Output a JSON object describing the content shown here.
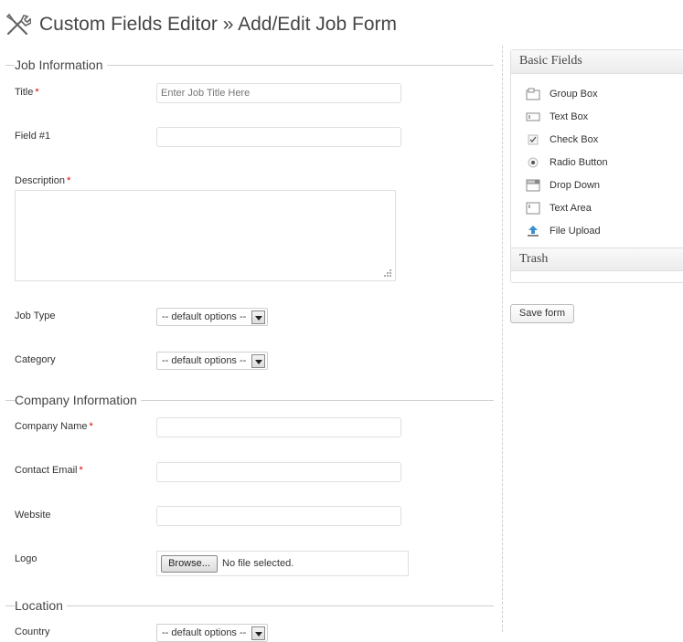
{
  "header": {
    "title": "Custom Fields Editor » Add/Edit Job Form",
    "icon": "tools-icon"
  },
  "sections": {
    "job": {
      "legend": "Job Information",
      "title_label": "Title",
      "title_placeholder": "Enter Job Title Here",
      "field1_label": "Field #1",
      "description_label": "Description",
      "job_type_label": "Job Type",
      "job_type_value": "-- default options --",
      "category_label": "Category",
      "category_value": "-- default options --"
    },
    "company": {
      "legend": "Company Information",
      "company_name_label": "Company Name",
      "contact_email_label": "Contact Email",
      "website_label": "Website",
      "logo_label": "Logo",
      "browse_label": "Browse...",
      "file_status": "No file selected."
    },
    "location": {
      "legend": "Location",
      "country_label": "Country",
      "country_value": "-- default options --"
    }
  },
  "required_mark": "*",
  "sidebar": {
    "basic_fields_title": "Basic Fields",
    "items": [
      {
        "label": "Group Box",
        "icon": "group-box-icon"
      },
      {
        "label": "Text Box",
        "icon": "text-box-icon"
      },
      {
        "label": "Check Box",
        "icon": "check-box-icon"
      },
      {
        "label": "Radio Button",
        "icon": "radio-button-icon"
      },
      {
        "label": "Drop Down",
        "icon": "drop-down-icon"
      },
      {
        "label": "Text Area",
        "icon": "text-area-icon"
      },
      {
        "label": "File Upload",
        "icon": "file-upload-icon"
      }
    ],
    "trash_title": "Trash",
    "save_label": "Save form"
  },
  "colors": {
    "required": "#dd0000",
    "upload_accent": "#3a8fd0"
  }
}
